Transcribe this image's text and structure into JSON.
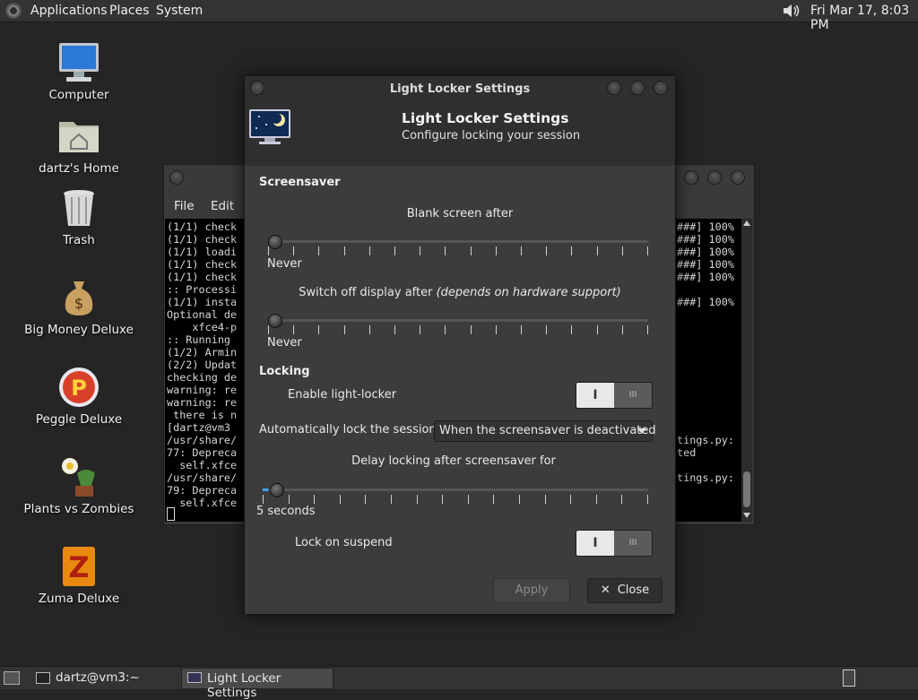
{
  "top_panel": {
    "menus": [
      "Applications",
      "Places",
      "System"
    ],
    "clock": "Fri Mar 17,  8:03 PM"
  },
  "desktop_icons": [
    {
      "label": "Computer",
      "icon": "computer-icon"
    },
    {
      "label": "dartz's Home",
      "icon": "home-folder-icon"
    },
    {
      "label": "Trash",
      "icon": "trash-icon"
    },
    {
      "label": "Big Money Deluxe",
      "icon": "money-bag-icon"
    },
    {
      "label": "Peggle Deluxe",
      "icon": "peggle-icon"
    },
    {
      "label": "Plants vs Zombies",
      "icon": "plants-vs-zombies-icon"
    },
    {
      "label": "Zuma Deluxe",
      "icon": "zuma-icon"
    }
  ],
  "terminal": {
    "menu": [
      "File",
      "Edit"
    ],
    "lines_left": [
      "(1/1) check",
      "(1/1) check",
      "(1/1) loadi",
      "(1/1) check",
      "(1/1) check",
      ":: Processi",
      "(1/1) insta",
      "Optional de",
      "    xfce4-p",
      ":: Running ",
      "(1/2) Armin",
      "(2/2) Updat",
      "checking de",
      "warning: re",
      "warning: re",
      " there is n",
      "[dartz@vm3 ",
      "/usr/share/",
      "77: Depreca",
      "  self.xfce",
      "/usr/share/",
      "79: Depreca",
      "  self.xfce"
    ],
    "lines_right": [
      "###] 100%",
      "###] 100%",
      "###] 100%",
      "###] 100%",
      "###] 100%",
      "",
      "###] 100%",
      "",
      "",
      "",
      "",
      "",
      "",
      "",
      "",
      "",
      "",
      "tings.py:",
      "ted",
      "",
      "tings.py:",
      "",
      ""
    ]
  },
  "dialog": {
    "window_title": "Light Locker Settings",
    "header_title": "Light Locker Settings",
    "header_subtitle": "Configure locking your session",
    "screensaver": {
      "section": "Screensaver",
      "blank_label": "Blank screen after",
      "blank_value": "Never",
      "switch_off_label": "Switch off display after ",
      "switch_off_hint": "(depends on hardware support)",
      "switch_off_value": "Never"
    },
    "locking": {
      "section": "Locking",
      "enable_label": "Enable light-locker",
      "auto_lock_label": "Automatically lock the session",
      "auto_lock_value": "When the screensaver is deactivated",
      "delay_label": "Delay locking after screensaver for",
      "delay_value": "5 seconds",
      "suspend_label": "Lock on suspend"
    },
    "toggle_on_glyph": "I",
    "toggle_off_glyph": "III",
    "apply_label": "Apply",
    "close_label": "Close",
    "slider_blank_level": 0,
    "slider_switch_off_level": 0,
    "slider_delay_level": 0.02
  },
  "taskbar": {
    "tasks": [
      "dartz@vm3:~",
      "Light Locker Settings"
    ]
  }
}
